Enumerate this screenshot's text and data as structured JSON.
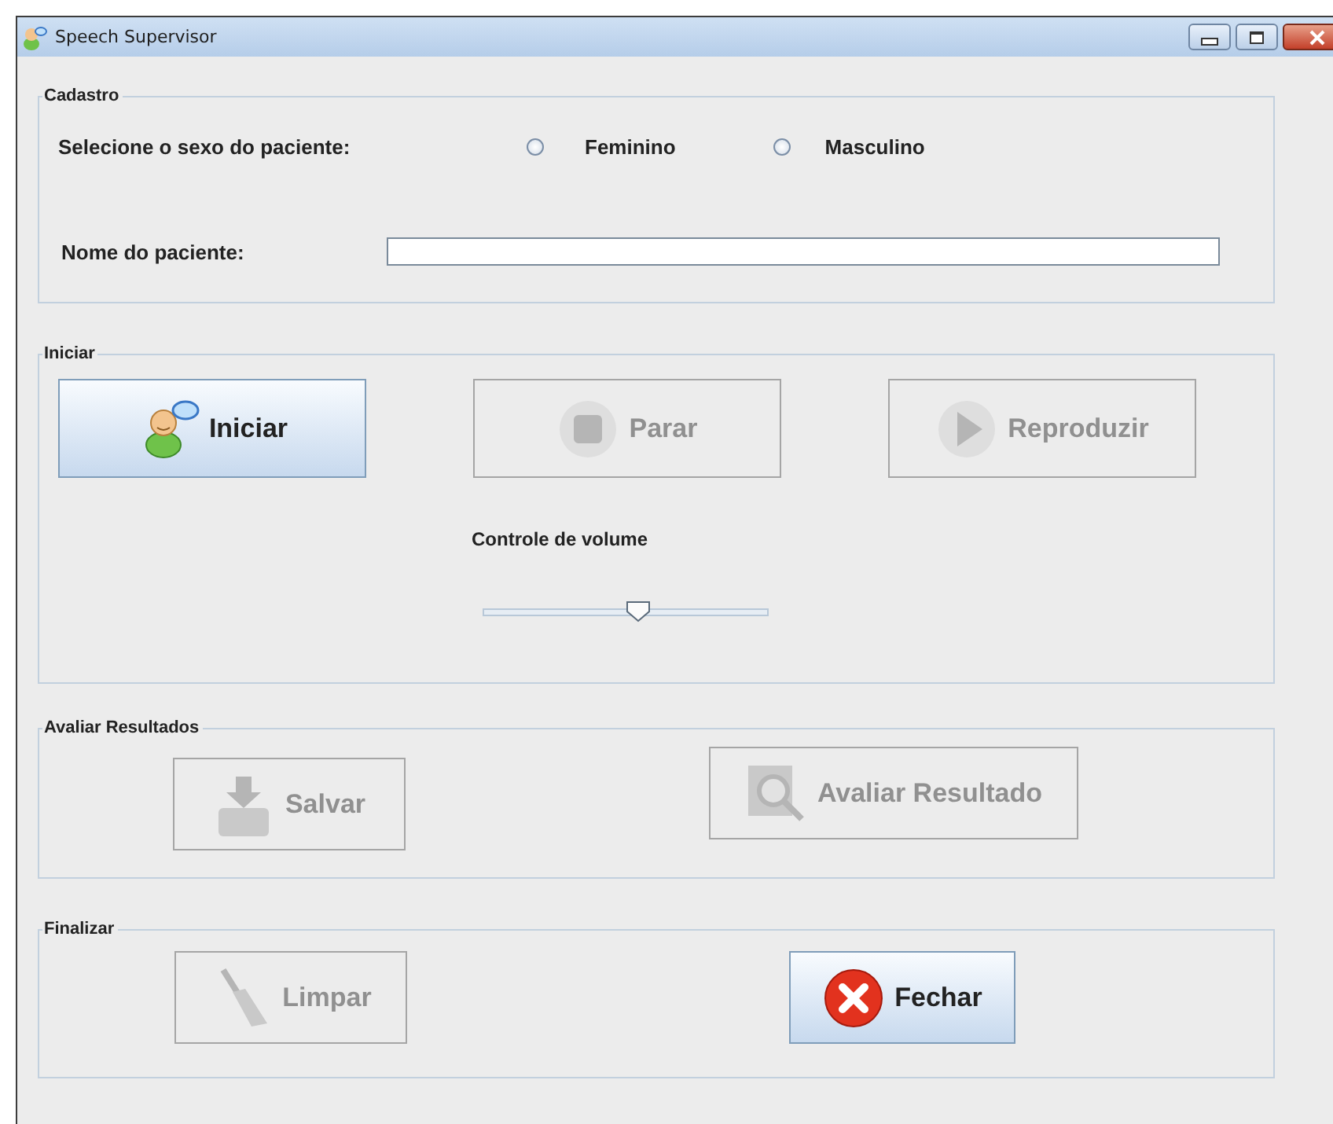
{
  "window": {
    "title": "Speech Supervisor"
  },
  "cadastro": {
    "title": "Cadastro",
    "sex_label": "Selecione o sexo do paciente:",
    "options": [
      {
        "label": "Feminino",
        "selected": false
      },
      {
        "label": "Masculino",
        "selected": false
      }
    ],
    "name_label": "Nome do paciente:"
  },
  "iniciar": {
    "title": "Iniciar",
    "buttons": [
      {
        "label": "Iniciar",
        "disabled": false
      },
      {
        "label": "Parar",
        "disabled": true
      },
      {
        "label": "Reproduzir",
        "disabled": true
      }
    ],
    "volume": {
      "label": "Controle de volume",
      "level": 0.5
    }
  },
  "avaliar": {
    "title": "Avaliar Resultados",
    "buttons": [
      {
        "label": "Salvar",
        "disabled": true
      },
      {
        "label": "Avaliar Resultado",
        "disabled": true
      }
    ]
  },
  "finalizar": {
    "title": "Finalizar",
    "buttons": [
      {
        "label": "Limpar",
        "disabled": true
      },
      {
        "label": "Fechar",
        "disabled": false
      }
    ]
  }
}
